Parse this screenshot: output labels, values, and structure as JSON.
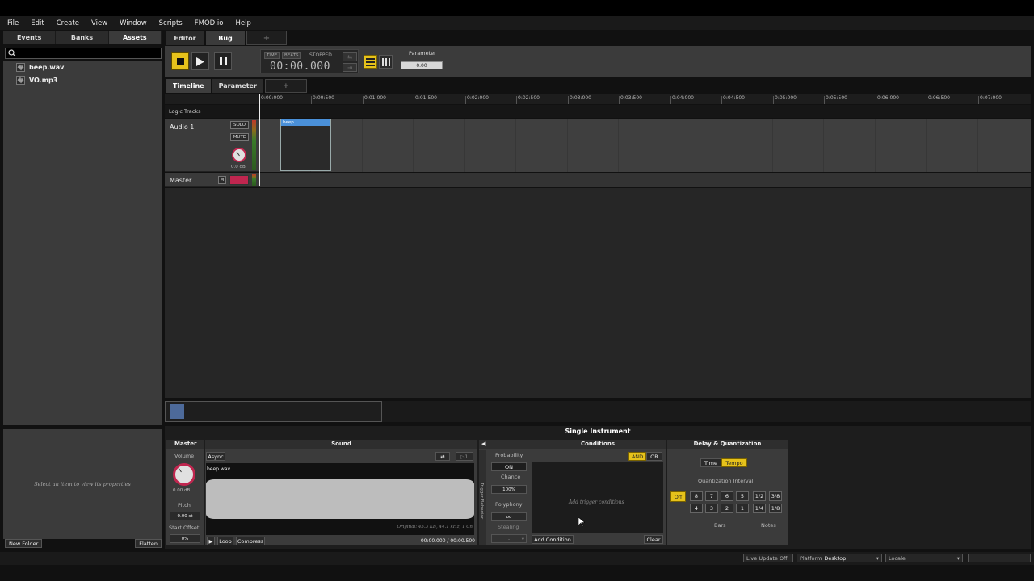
{
  "menu": [
    "File",
    "Edit",
    "Create",
    "View",
    "Window",
    "Scripts",
    "FMOD.io",
    "Help"
  ],
  "left_tabs": [
    "Events",
    "Banks",
    "Assets"
  ],
  "assets": [
    {
      "name": "beep.wav",
      "icon": "audio-file-icon"
    },
    {
      "name": "VO.mp3",
      "icon": "audio-file-icon"
    }
  ],
  "left_props_placeholder": "Select an item to view its properties",
  "left_buttons": {
    "new_folder": "New Folder",
    "flatten": "Flatten"
  },
  "editor_tabs": [
    "Editor",
    "Bug",
    "+"
  ],
  "transport": {
    "time_label": "TIME",
    "beats_label": "BEATS",
    "state": "STOPPED",
    "time": "00:00.000",
    "parameter_label": "Parameter",
    "parameter_value": "0.00"
  },
  "sub_tabs": [
    "Timeline",
    "Parameter",
    "+"
  ],
  "ruler_ticks": [
    "0:00:000",
    "0:00:500",
    "0:01:000",
    "0:01:500",
    "0:02:000",
    "0:02:500",
    "0:03:000",
    "0:03:500",
    "0:04:000",
    "0:04:500",
    "0:05:000",
    "0:05:500",
    "0:06:000",
    "0:06:500",
    "0:07:000"
  ],
  "logic_tracks": "Logic Tracks",
  "audio_track": {
    "name": "Audio 1",
    "solo": "SOLO",
    "mute": "MUTE",
    "volume": "0.0 dB"
  },
  "clip": {
    "name": "beep"
  },
  "master_track": {
    "name": "Master",
    "m": "M"
  },
  "deck": {
    "title": "Single Instrument",
    "master": {
      "header": "Master",
      "volume_label": "Volume",
      "volume_value": "0.00 dB",
      "pitch_label": "Pitch",
      "pitch_value": "0.00 st",
      "start_offset_label": "Start Offset",
      "start_offset_value": "0%"
    },
    "sound": {
      "header": "Sound",
      "async": "Async",
      "loop_count": "1",
      "file": "beep.wav",
      "info": "Original: 45.3 KB, 44.1 kHz, 1 Ch",
      "time": "00:00.000 / 00:00.500",
      "loop": "Loop",
      "compress": "Compress"
    },
    "trigger": {
      "side_label": "Trigger Behavior",
      "probability": "Probability",
      "on": "ON",
      "chance": "Chance",
      "chance_value": "100%",
      "polyphony": "Polyphony",
      "polyphony_value": "oo",
      "stealing": "Stealing",
      "stealing_value": "-"
    },
    "conditions": {
      "header": "Conditions",
      "and": "AND",
      "or": "OR",
      "placeholder": "Add trigger conditions",
      "add": "Add Condition",
      "clear": "Clear"
    },
    "delay": {
      "header": "Delay & Quantization",
      "time": "Time",
      "tempo": "Tempo",
      "interval_label": "Quantization Interval",
      "off": "Off",
      "bars_row1": [
        "8",
        "7",
        "6",
        "5"
      ],
      "bars_row2": [
        "4",
        "3",
        "2",
        "1"
      ],
      "notes_row1": [
        "1/2",
        "3/8"
      ],
      "notes_row2": [
        "1/4",
        "1/8"
      ],
      "bars_label": "Bars",
      "notes_label": "Notes"
    }
  },
  "status": {
    "live_update": "Live Update Off",
    "platform_label": "Platform",
    "platform_value": "Desktop",
    "locale_label": "Locale"
  },
  "colors": {
    "accent": "#e6c21b",
    "clip": "#4a90d9",
    "knob_ring": "#c0264f"
  }
}
